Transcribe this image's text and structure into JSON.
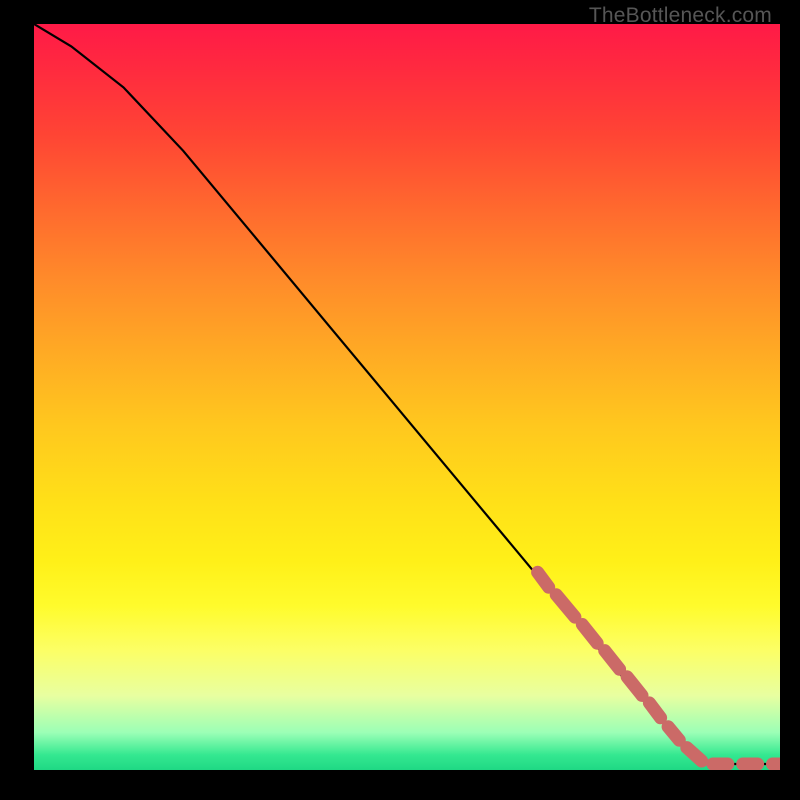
{
  "watermark": "TheBottleneck.com",
  "chart_data": {
    "type": "line",
    "title": "",
    "xlabel": "",
    "ylabel": "",
    "xlim": [
      0,
      100
    ],
    "ylim": [
      0,
      100
    ],
    "curve": [
      {
        "x": 0,
        "y": 100
      },
      {
        "x": 5,
        "y": 97
      },
      {
        "x": 12,
        "y": 91.5
      },
      {
        "x": 20,
        "y": 83
      },
      {
        "x": 30,
        "y": 71
      },
      {
        "x": 40,
        "y": 59
      },
      {
        "x": 50,
        "y": 47
      },
      {
        "x": 60,
        "y": 35
      },
      {
        "x": 70,
        "y": 23
      },
      {
        "x": 78,
        "y": 13.5
      },
      {
        "x": 85,
        "y": 5.5
      },
      {
        "x": 89,
        "y": 1.5
      },
      {
        "x": 92,
        "y": 0.8
      },
      {
        "x": 100,
        "y": 0.8
      }
    ],
    "dash_segments": [
      {
        "x1": 67.5,
        "y1": 26.5,
        "x2": 69.0,
        "y2": 24.5
      },
      {
        "x1": 70.0,
        "y1": 23.5,
        "x2": 72.5,
        "y2": 20.5
      },
      {
        "x1": 73.5,
        "y1": 19.5,
        "x2": 75.5,
        "y2": 17.0
      },
      {
        "x1": 76.5,
        "y1": 16.0,
        "x2": 78.5,
        "y2": 13.5
      },
      {
        "x1": 79.5,
        "y1": 12.5,
        "x2": 81.5,
        "y2": 10.0
      },
      {
        "x1": 82.5,
        "y1": 9.0,
        "x2": 84.0,
        "y2": 7.0
      },
      {
        "x1": 85.0,
        "y1": 5.8,
        "x2": 86.5,
        "y2": 4.0
      },
      {
        "x1": 87.5,
        "y1": 3.0,
        "x2": 89.5,
        "y2": 1.2
      },
      {
        "x1": 91.0,
        "y1": 0.8,
        "x2": 93.0,
        "y2": 0.8
      },
      {
        "x1": 95.0,
        "y1": 0.8,
        "x2": 97.0,
        "y2": 0.8
      },
      {
        "x1": 99.0,
        "y1": 0.8,
        "x2": 100.0,
        "y2": 0.8
      }
    ],
    "colors": {
      "curve": "#000000",
      "dash": "#cb6a67"
    }
  }
}
